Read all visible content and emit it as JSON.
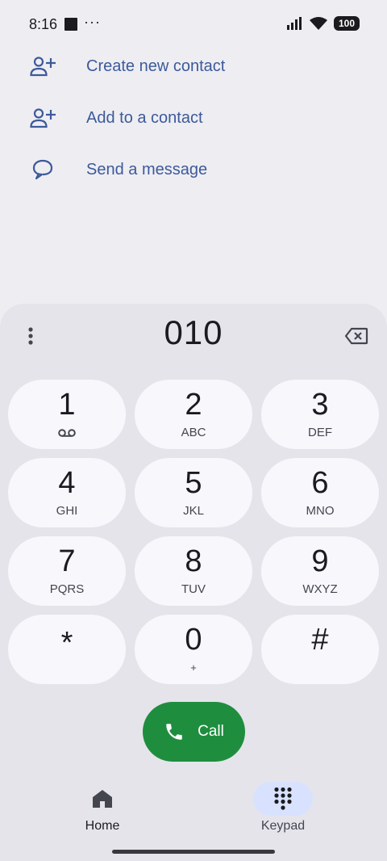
{
  "status_bar": {
    "time": "8:16",
    "dots": "···",
    "battery": "100",
    "icons": [
      "media-icon",
      "signal-icon",
      "wifi-icon",
      "battery-icon"
    ]
  },
  "actions": [
    {
      "label": "Create new contact",
      "icon": "add-person-icon"
    },
    {
      "label": "Add to a contact",
      "icon": "add-person-icon"
    },
    {
      "label": "Send a message",
      "icon": "message-icon"
    }
  ],
  "dialer": {
    "number": "010",
    "more_icon": "more-vert-icon",
    "backspace_icon": "backspace-icon"
  },
  "keys": [
    {
      "digit": "1",
      "letters": ""
    },
    {
      "digit": "2",
      "letters": "ABC"
    },
    {
      "digit": "3",
      "letters": "DEF"
    },
    {
      "digit": "4",
      "letters": "GHI"
    },
    {
      "digit": "5",
      "letters": "JKL"
    },
    {
      "digit": "6",
      "letters": "MNO"
    },
    {
      "digit": "7",
      "letters": "PQRS"
    },
    {
      "digit": "8",
      "letters": "TUV"
    },
    {
      "digit": "9",
      "letters": "WXYZ"
    },
    {
      "digit": "*",
      "letters": ""
    },
    {
      "digit": "0",
      "letters": "+"
    },
    {
      "digit": "#",
      "letters": ""
    }
  ],
  "call_button": {
    "label": "Call",
    "icon": "phone-icon"
  },
  "bottom_nav": {
    "home": {
      "label": "Home",
      "icon": "home-icon"
    },
    "keypad": {
      "label": "Keypad",
      "icon": "dialpad-icon",
      "selected": true
    }
  },
  "colors": {
    "background": "#EEEDF2",
    "sheet": "#E5E4EB",
    "key": "#F8F7FC",
    "accent_text": "#3C5A99",
    "call_green": "#1E8E3E",
    "nav_selected": "#D8E2FF"
  }
}
